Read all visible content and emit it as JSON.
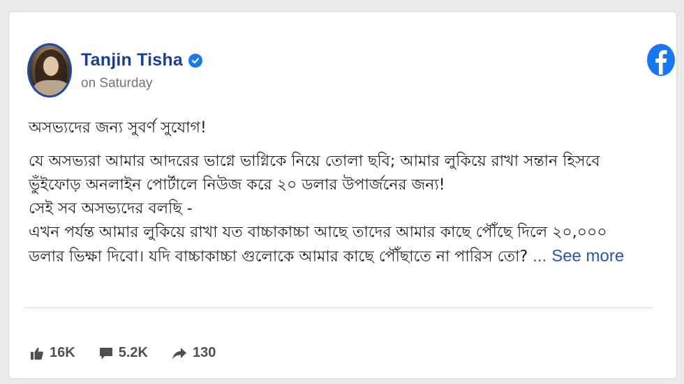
{
  "post": {
    "author": "Tanjin Tisha",
    "verified": true,
    "time": "on Saturday",
    "platform_icon": "facebook-icon",
    "text_lines": [
      "অসভ্যদের জন্য সুবর্ণ সুযোগ!",
      "যে অসভ্যরা আমার আদরের ভাগ্নে ভাগ্নিকে নিয়ে তোলা ছবি; আমার লুকিয়ে রাখা সন্তান হিসবে",
      "ভুঁইফোড় অনলাইন পোর্টালে নিউজ করে ২০ ডলার উপার্জনের জন্য!",
      "সেই সব অসভ্যদের বলছি -",
      "এখন পর্যন্ত আমার লুকিয়ে রাখা যত বাচ্চাকাচ্চা আছে তাদের আমার কাছে পৌঁছে দিলে ২০,০০০",
      "ডলার ভিক্ষা দিবো। যদি বাচ্চাকাচ্চা গুলোকে আমার কাছে পৌঁছাতে না পারিস তো?"
    ],
    "ellipsis": "...",
    "see_more": "See more",
    "reactions": {
      "likes": "16K",
      "comments": "5.2K",
      "shares": "130"
    }
  },
  "colors": {
    "author": "#1b3f8f",
    "link": "#2a55b5",
    "facebook": "#1877f2"
  }
}
